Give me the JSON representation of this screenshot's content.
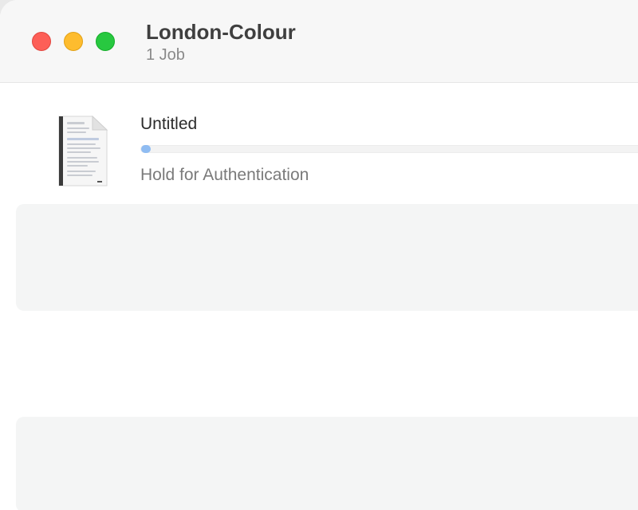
{
  "window": {
    "title": "London-Colour",
    "subtitle": "1 Job"
  },
  "jobs": [
    {
      "name": "Untitled",
      "status": "Hold for Authentication",
      "progress_fraction": 0.0,
      "thumbnail_icon": "document-thumbnail-icon"
    }
  ],
  "colors": {
    "close": "#fd5f57",
    "minimize": "#febc2e",
    "zoom": "#28c840",
    "progress": "#8fbcf2"
  }
}
